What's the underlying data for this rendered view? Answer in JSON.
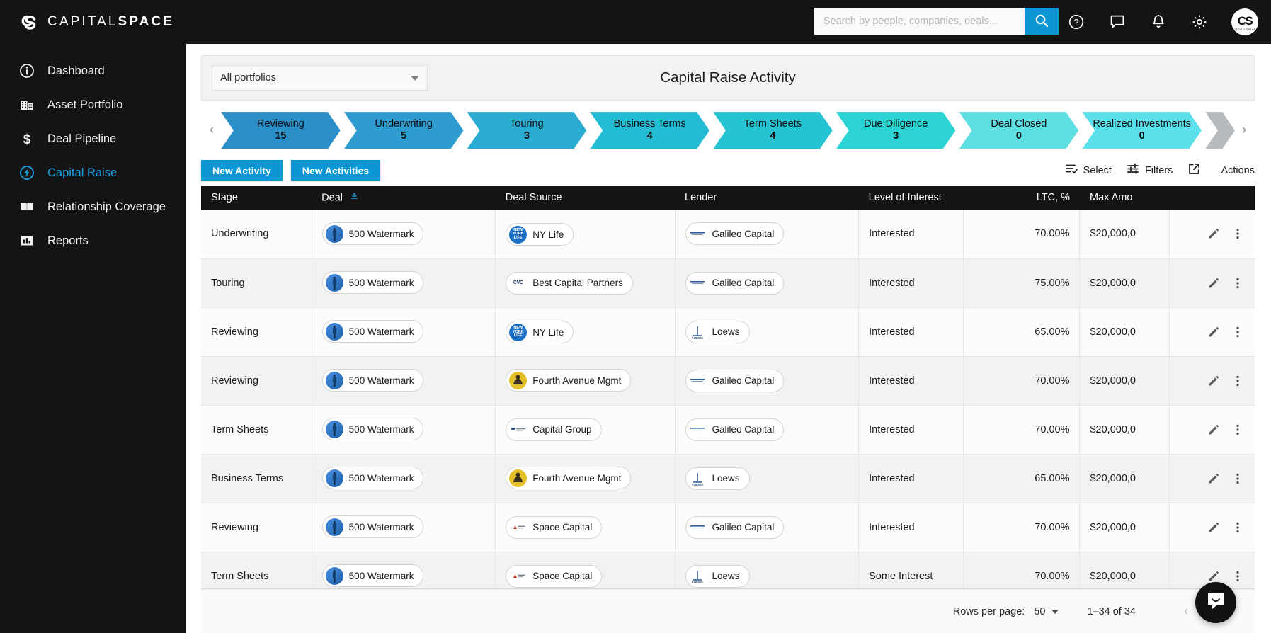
{
  "brand": {
    "logo_light": "CAPITAL",
    "logo_bold": "SPACE",
    "logo_mark": "cs-monogram-icon",
    "accent": "#0b97d4",
    "dark": "#141414"
  },
  "topbar": {
    "search": {
      "value": "",
      "placeholder": "Search by people, companies, deals...",
      "button_icon": "search-icon"
    },
    "icons": [
      {
        "name": "help-icon",
        "glyph": "?"
      },
      {
        "name": "chat-icon",
        "glyph": ""
      },
      {
        "name": "notifications-bell-icon",
        "glyph": ""
      },
      {
        "name": "settings-gear-icon",
        "glyph": ""
      }
    ],
    "avatar": {
      "initials": "CS",
      "subtext": "CAPITALSPACE"
    }
  },
  "sidebar": {
    "items": [
      {
        "label": "Dashboard",
        "icon": "info-circle-icon",
        "active": false
      },
      {
        "label": "Asset Portfolio",
        "icon": "building-icon",
        "active": false
      },
      {
        "label": "Deal Pipeline",
        "icon": "dollar-icon",
        "active": false
      },
      {
        "label": "Capital Raise",
        "icon": "bolt-circle-icon",
        "active": true
      },
      {
        "label": "Relationship Coverage",
        "icon": "open-book-icon",
        "active": false
      },
      {
        "label": "Reports",
        "icon": "bar-chart-icon",
        "active": false
      }
    ]
  },
  "panel": {
    "title": "Capital Raise Activity",
    "portfolio_filter": {
      "value": "All portfolios",
      "caret": "chevron-down-icon"
    }
  },
  "stages": {
    "prev_icon": "chevron-left-icon",
    "next_icon": "chevron-right-icon",
    "items": [
      {
        "name": "Reviewing",
        "count": "15",
        "color": "#2a8ec9"
      },
      {
        "name": "Underwriting",
        "count": "5",
        "color": "#2e9ccf"
      },
      {
        "name": "Touring",
        "count": "3",
        "color": "#2aabd2"
      },
      {
        "name": "Business Terms",
        "count": "4",
        "color": "#23bcd4"
      },
      {
        "name": "Term Sheets",
        "count": "4",
        "color": "#26c4d2"
      },
      {
        "name": "Due Diligence",
        "count": "3",
        "color": "#2bd3d5"
      },
      {
        "name": "Deal Closed",
        "count": "0",
        "color": "#5fdfe2"
      },
      {
        "name": "Realized Investments",
        "count": "0",
        "color": "#5ce0ec"
      },
      {
        "name": "",
        "count": "",
        "color": "#b4babd"
      }
    ]
  },
  "toolbar": {
    "new_activity": "New Activity",
    "new_activities": "New Activities",
    "select": {
      "label": "Select",
      "icon": "list-check-icon"
    },
    "filters": {
      "label": "Filters",
      "icon": "sliders-icon"
    },
    "export": {
      "label": "",
      "icon": "external-link-icon"
    },
    "actions": {
      "label": "Actions"
    }
  },
  "table": {
    "columns": [
      {
        "key": "stage",
        "label": "Stage",
        "align": "left"
      },
      {
        "key": "deal",
        "label": "Deal",
        "align": "left",
        "sort": "asc",
        "sort_icon": "sort-ascending-icon"
      },
      {
        "key": "source",
        "label": "Deal Source",
        "align": "left"
      },
      {
        "key": "lender",
        "label": "Lender",
        "align": "left"
      },
      {
        "key": "level",
        "label": "Level of Interest",
        "align": "left"
      },
      {
        "key": "ltc",
        "label": "LTC, %",
        "align": "right"
      },
      {
        "key": "max",
        "label": "Max Amo",
        "align": "left"
      },
      {
        "key": "act",
        "label": "",
        "align": "right"
      }
    ],
    "row_icons": {
      "edit": "pencil-icon",
      "menu": "more-vertical-icon"
    },
    "rows": [
      {
        "stage": "Underwriting",
        "deal": "500 Watermark",
        "deal_logo": "watermark-tower-logo",
        "source": "NY Life",
        "source_logo": "ny-life-logo",
        "lender": "Galileo Capital",
        "lender_logo": "galileo-capital-logo",
        "level": "Interested",
        "ltc": "70.00%",
        "max": "$20,000,0"
      },
      {
        "stage": "Touring",
        "deal": "500 Watermark",
        "deal_logo": "watermark-tower-logo",
        "source": "Best Capital Partners",
        "source_logo": "cvc-logo",
        "lender": "Galileo Capital",
        "lender_logo": "galileo-capital-logo",
        "level": "Interested",
        "ltc": "75.00%",
        "max": "$20,000,0"
      },
      {
        "stage": "Reviewing",
        "deal": "500 Watermark",
        "deal_logo": "watermark-tower-logo",
        "source": "NY Life",
        "source_logo": "ny-life-logo",
        "lender": "Loews",
        "lender_logo": "loews-logo",
        "level": "Interested",
        "ltc": "65.00%",
        "max": "$20,000,0"
      },
      {
        "stage": "Reviewing",
        "deal": "500 Watermark",
        "deal_logo": "watermark-tower-logo",
        "source": "Fourth Avenue Mgmt",
        "source_logo": "fourth-avenue-logo",
        "lender": "Galileo Capital",
        "lender_logo": "galileo-capital-logo",
        "level": "Interested",
        "ltc": "70.00%",
        "max": "$20,000,0"
      },
      {
        "stage": "Term Sheets",
        "deal": "500 Watermark",
        "deal_logo": "watermark-tower-logo",
        "source": "Capital Group",
        "source_logo": "capital-group-logo",
        "lender": "Galileo Capital",
        "lender_logo": "galileo-capital-logo",
        "level": "Interested",
        "ltc": "70.00%",
        "max": "$20,000,0"
      },
      {
        "stage": "Business Terms",
        "deal": "500 Watermark",
        "deal_logo": "watermark-tower-logo",
        "source": "Fourth Avenue Mgmt",
        "source_logo": "fourth-avenue-logo",
        "lender": "Loews",
        "lender_logo": "loews-logo",
        "level": "Interested",
        "ltc": "65.00%",
        "max": "$20,000,0"
      },
      {
        "stage": "Reviewing",
        "deal": "500 Watermark",
        "deal_logo": "watermark-tower-logo",
        "source": "Space Capital",
        "source_logo": "space-capital-logo",
        "lender": "Galileo Capital",
        "lender_logo": "galileo-capital-logo",
        "level": "Interested",
        "ltc": "70.00%",
        "max": "$20,000,0"
      },
      {
        "stage": "Term Sheets",
        "deal": "500 Watermark",
        "deal_logo": "watermark-tower-logo",
        "source": "Space Capital",
        "source_logo": "space-capital-logo",
        "lender": "Loews",
        "lender_logo": "loews-logo",
        "level": "Some Interest",
        "ltc": "70.00%",
        "max": "$20,000,0"
      }
    ]
  },
  "footer": {
    "rows_per_page_label": "Rows per page:",
    "rows_per_page_value": "50",
    "range": "1–34 of 34",
    "prev_icon": "chevron-left-icon",
    "next_icon": "chevron-right-icon",
    "chat_fab_icon": "intercom-chat-icon"
  }
}
